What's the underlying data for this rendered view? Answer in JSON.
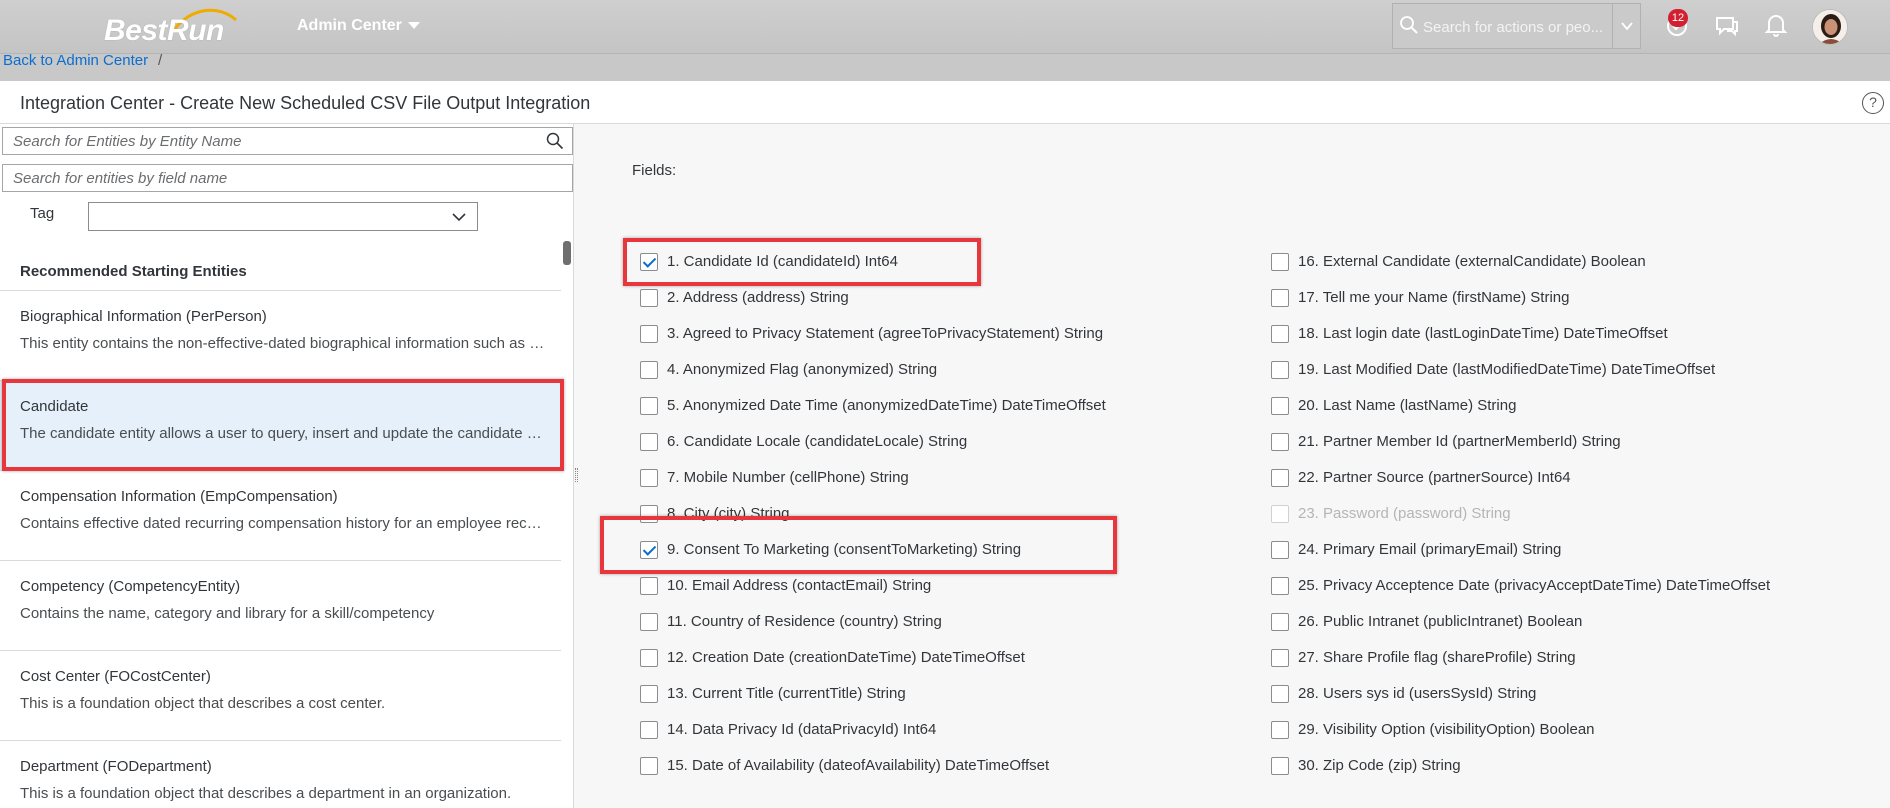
{
  "shell": {
    "logo_text": "BestRun",
    "menu_title": "Admin Center",
    "search_placeholder": "Search for actions or peo...",
    "notification_count": "12",
    "icons": [
      "search-icon",
      "chevron-down-icon",
      "notification-icon",
      "chat-icon",
      "bell-icon",
      "avatar"
    ],
    "accent_color": "#0a6ed1",
    "badge_color": "#d32030",
    "highlight_color": "#e8373c"
  },
  "breadcrumb": {
    "link": "Back to Admin Center",
    "separator": "/"
  },
  "page": {
    "title": "Integration Center - Create New Scheduled CSV File Output Integration",
    "help_label": "?"
  },
  "left_pane": {
    "entity_search_placeholder": "Search for Entities by Entity Name",
    "field_search_placeholder": "Search for entities by field name",
    "tag_label": "Tag",
    "tag_value": "",
    "list_header": "Recommended Starting Entities",
    "entities": [
      {
        "name": "Biographical Information (PerPerson)",
        "desc": "This entity contains the non-effective-dated biographical information such as date and place of birth"
      },
      {
        "name": "Candidate",
        "desc": "The candidate entity allows a user to query, insert and update the candidate profile information",
        "selected": true
      },
      {
        "name": "Compensation Information (EmpCompensation)",
        "desc": "Contains effective dated recurring compensation history for an employee record"
      },
      {
        "name": "Competency (CompetencyEntity)",
        "desc": "Contains the name, category and library for a skill/competency"
      },
      {
        "name": "Cost Center (FOCostCenter)",
        "desc": "This is a foundation object that describes a cost center."
      },
      {
        "name": "Department (FODepartment)",
        "desc": "This is a foundation object that describes a department in an organization."
      }
    ]
  },
  "right_pane": {
    "fields_label": "Fields:",
    "fields_left": [
      {
        "label": "1. Candidate Id (candidateId) Int64",
        "checked": true
      },
      {
        "label": "2. Address (address) String",
        "checked": false
      },
      {
        "label": "3. Agreed to Privacy Statement (agreeToPrivacyStatement) String",
        "checked": false
      },
      {
        "label": "4. Anonymized Flag (anonymized) String",
        "checked": false
      },
      {
        "label": "5. Anonymized Date Time (anonymizedDateTime) DateTimeOffset",
        "checked": false
      },
      {
        "label": "6. Candidate Locale (candidateLocale) String",
        "checked": false
      },
      {
        "label": "7. Mobile Number (cellPhone) String",
        "checked": false
      },
      {
        "label": "8. City (city) String",
        "checked": false
      },
      {
        "label": "9. Consent To Marketing (consentToMarketing) String",
        "checked": true
      },
      {
        "label": "10. Email Address (contactEmail) String",
        "checked": false
      },
      {
        "label": "11. Country of Residence (country) String",
        "checked": false
      },
      {
        "label": "12. Creation Date (creationDateTime) DateTimeOffset",
        "checked": false
      },
      {
        "label": "13. Current Title (currentTitle) String",
        "checked": false
      },
      {
        "label": "14. Data Privacy Id (dataPrivacyId) Int64",
        "checked": false
      },
      {
        "label": "15. Date of Availability (dateofAvailability) DateTimeOffset",
        "checked": false
      }
    ],
    "fields_right": [
      {
        "label": "16. External Candidate (externalCandidate) Boolean",
        "checked": false
      },
      {
        "label": "17. Tell me your Name (firstName) String",
        "checked": false
      },
      {
        "label": "18. Last login date (lastLoginDateTime) DateTimeOffset",
        "checked": false
      },
      {
        "label": "19. Last Modified Date (lastModifiedDateTime) DateTimeOffset",
        "checked": false
      },
      {
        "label": "20. Last Name (lastName) String",
        "checked": false
      },
      {
        "label": "21. Partner Member Id (partnerMemberId) String",
        "checked": false
      },
      {
        "label": "22. Partner Source (partnerSource) Int64",
        "checked": false
      },
      {
        "label": "23. Password (password) String",
        "checked": false,
        "disabled": true
      },
      {
        "label": "24. Primary Email (primaryEmail) String",
        "checked": false
      },
      {
        "label": "25. Privacy Acceptence Date (privacyAcceptDateTime) DateTimeOffset",
        "checked": false
      },
      {
        "label": "26. Public Intranet (publicIntranet) Boolean",
        "checked": false
      },
      {
        "label": "27. Share Profile flag (shareProfile) String",
        "checked": false
      },
      {
        "label": "28. Users sys id (usersSysId) String",
        "checked": false
      },
      {
        "label": "29. Visibility Option (visibilityOption) Boolean",
        "checked": false
      },
      {
        "label": "30. Zip Code (zip) String",
        "checked": false
      }
    ]
  }
}
